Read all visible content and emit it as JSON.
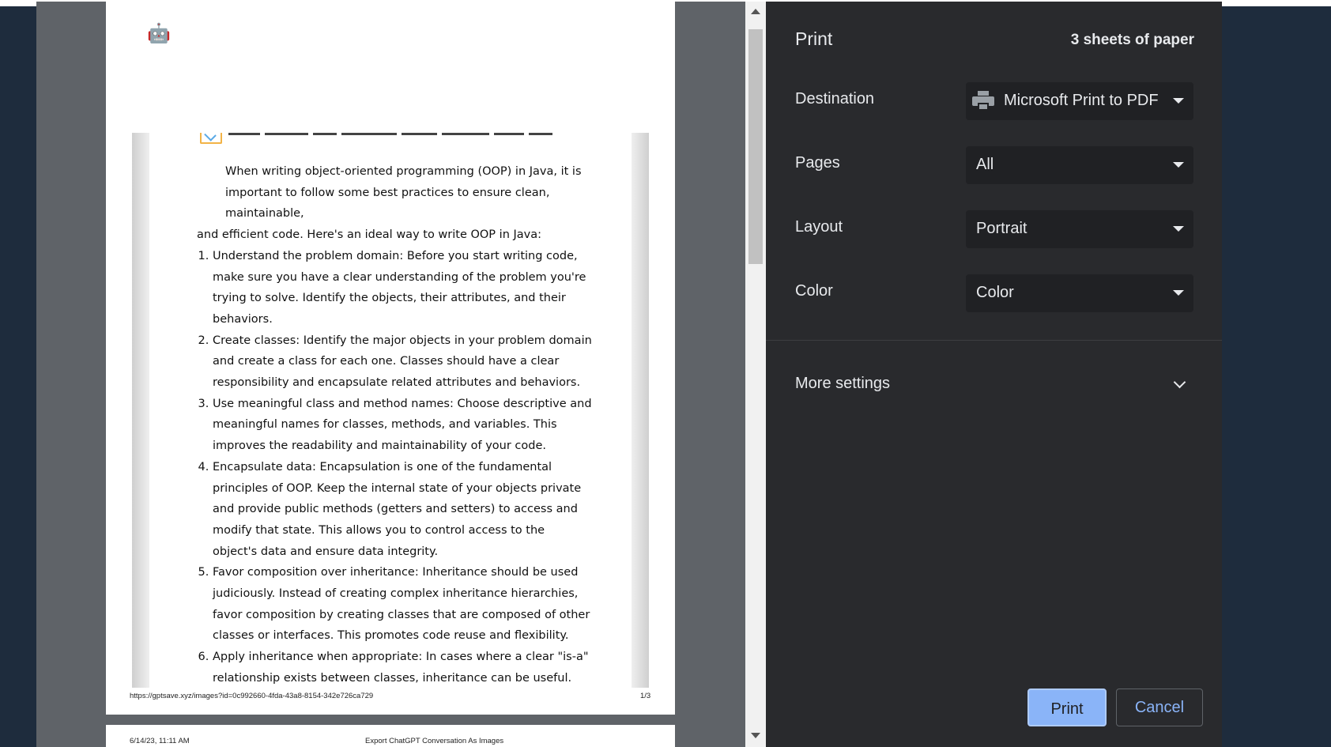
{
  "preview": {
    "page1": {
      "robot_icon": "🤖",
      "intro_line1": "When writing object-oriented programming (OOP) in Java, it is important to follow some best practices to ensure clean, maintainable,",
      "intro_line2": "and efficient code. Here's an ideal way to write OOP in Java:",
      "items": [
        "Understand the problem domain: Before you start writing code, make sure you have a clear understanding of the problem you're trying to solve. Identify the objects, their attributes, and their behaviors.",
        "Create classes: Identify the major objects in your problem domain and create a class for each one. Classes should have a clear responsibility and encapsulate related attributes and behaviors.",
        "Use meaningful class and method names: Choose descriptive and meaningful names for classes, methods, and variables. This improves the readability and maintainability of your code.",
        "Encapsulate data: Encapsulation is one of the fundamental principles of OOP. Keep the internal state of your objects private and provide public methods (getters and setters) to access and modify that state. This allows you to control access to the object's data and ensure data integrity.",
        "Favor composition over inheritance: Inheritance should be used judiciously. Instead of creating complex inheritance hierarchies, favor composition by creating classes that are composed of other classes or interfaces. This promotes code reuse and flexibility.",
        "Apply inheritance when appropriate: In cases where a clear \"is-a\" relationship exists between classes, inheritance can be useful. However, make sure it is used for true specialization and not just code reuse."
      ],
      "footer_url": "https://gptsave.xyz/images?id=0c992660-4fda-43a8-8154-342e726ca729",
      "footer_page": "1/3"
    },
    "page2": {
      "header_date": "6/14/23, 11:11 AM",
      "header_title": "Export ChatGPT Conversation As Images"
    }
  },
  "sidebar": {
    "title": "Print",
    "sheets": "3 sheets of paper",
    "destination": {
      "label": "Destination",
      "value": "Microsoft Print to PDF",
      "icon": "printer-icon"
    },
    "pages": {
      "label": "Pages",
      "value": "All"
    },
    "layout": {
      "label": "Layout",
      "value": "Portrait"
    },
    "color": {
      "label": "Color",
      "value": "Color"
    },
    "more_settings": "More settings",
    "print_button": "Print",
    "cancel_button": "Cancel"
  },
  "colors": {
    "sidebar_bg": "#292a2d",
    "select_bg": "#202124",
    "accent": "#8ab4f8",
    "preview_bg": "#5f6368"
  }
}
